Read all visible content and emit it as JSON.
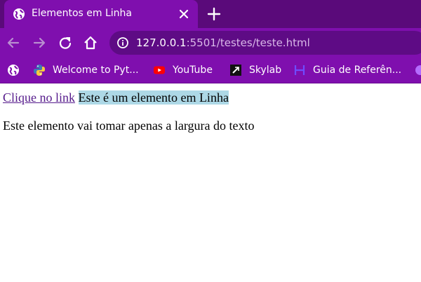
{
  "tab": {
    "title": "Elementos em Linha"
  },
  "omnibox": {
    "url_host": "127.0.0.1",
    "url_rest": ":5501/testes/teste.html"
  },
  "bookmarks": [
    {
      "label": "",
      "icon": "globe-icon"
    },
    {
      "label": "Welcome to Pyt...",
      "icon": "python-icon"
    },
    {
      "label": "YouTube",
      "icon": "youtube-icon"
    },
    {
      "label": "Skylab",
      "icon": "skylab-icon"
    },
    {
      "label": "Guia de Referên...",
      "icon": "guia-icon"
    }
  ],
  "page": {
    "link_text": "Clique no link",
    "span_text": "Este é um elemento em Linha",
    "paragraph_text": "Este elemento vai tomar apenas a largura do texto"
  },
  "colors": {
    "tabstrip": "#5a0a7a",
    "toolbar": "#7f0fae",
    "omnibox": "#5e0b85",
    "link": "#551a8b",
    "span_bg": "#add8e6"
  }
}
